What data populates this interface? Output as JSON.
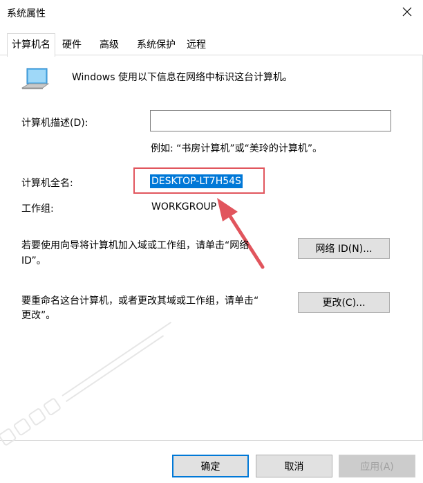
{
  "window": {
    "title": "系统属性"
  },
  "tabs": [
    {
      "label": "计算机名",
      "active": true
    },
    {
      "label": "硬件",
      "active": false
    },
    {
      "label": "高级",
      "active": false
    },
    {
      "label": "系统保护",
      "active": false
    },
    {
      "label": "远程",
      "active": false
    }
  ],
  "intro": {
    "text": "Windows 使用以下信息在网络中标识这台计算机。",
    "icon": "computer-monitor-icon"
  },
  "description": {
    "label": "计算机描述(D):",
    "value": "",
    "hint": "例如: “书房计算机”或“美玲的计算机”。"
  },
  "full_name": {
    "label": "计算机全名:",
    "value": "DESKTOP-LT7H54S"
  },
  "workgroup": {
    "label": "工作组:",
    "value": "WORKGROUP"
  },
  "network_id": {
    "text_line1": "若要使用向导将计算机加入域或工作组，请单击“网络",
    "text_line2": "ID”。",
    "button": "网络 ID(N)..."
  },
  "rename": {
    "text_line1": "要重命名这台计算机，或者更改其域或工作组，请单击“",
    "text_line2": "更改”。",
    "button": "更改(C)..."
  },
  "footer": {
    "ok": "确定",
    "cancel": "取消",
    "apply": "应用(A)"
  },
  "colors": {
    "selection": "#0078d7",
    "annotation": "#e1555d",
    "focus_border": "#0078d7"
  }
}
